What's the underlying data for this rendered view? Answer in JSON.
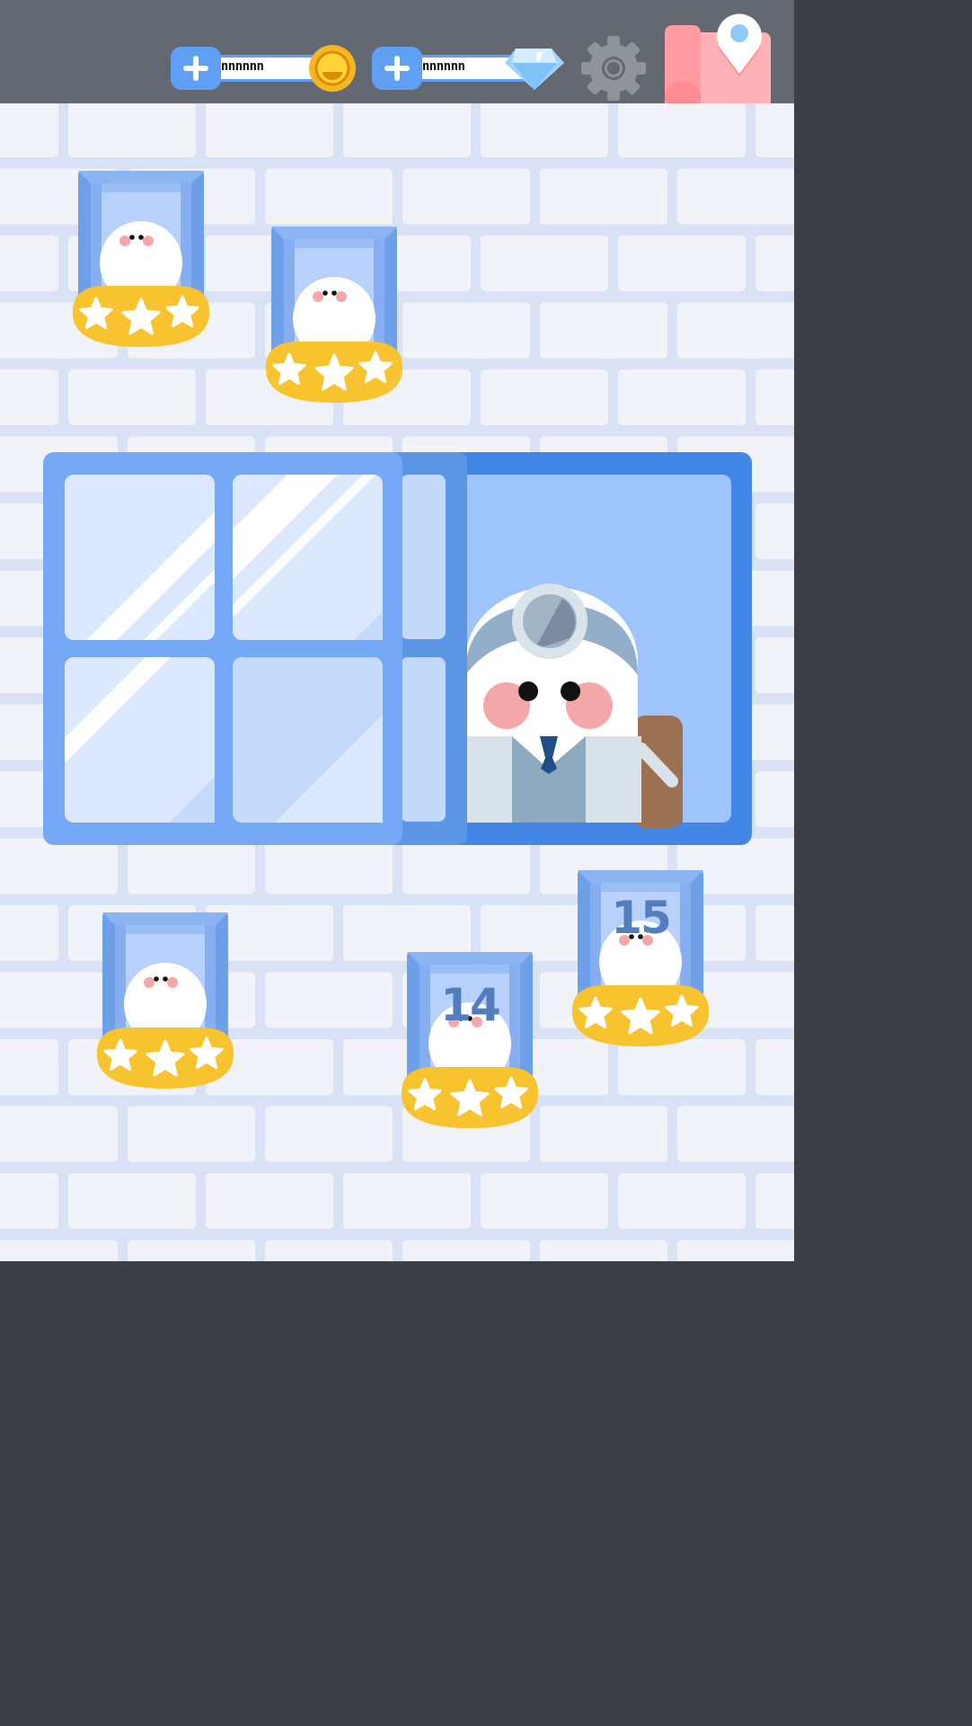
{
  "hud": {
    "coins": {
      "value": "nnnnnnnn",
      "add_icon": "plus-icon",
      "icon": "gold-coin-icon"
    },
    "gems": {
      "value": "nnnnnnnn",
      "add_icon": "plus-icon",
      "icon": "diamond-icon"
    },
    "settings_icon": "gear-icon",
    "map_icon": "map-pin-icon"
  },
  "levels": [
    {
      "number": "",
      "stars": 3,
      "locked": false
    },
    {
      "number": "",
      "stars": 3,
      "locked": false
    },
    {
      "number": "",
      "stars": 3,
      "locked": false
    },
    {
      "number": "14",
      "stars": 3,
      "locked": false
    },
    {
      "number": "15",
      "stars": 3,
      "locked": false
    }
  ],
  "featured": {
    "character": "doctor",
    "window": "open-window"
  },
  "colors": {
    "wall": "#f2f3f8",
    "mortar": "#d9e2f4",
    "window_blue": "#6aa2f2",
    "star_badge": "#f7c32e",
    "hud_bar": "#646871"
  }
}
